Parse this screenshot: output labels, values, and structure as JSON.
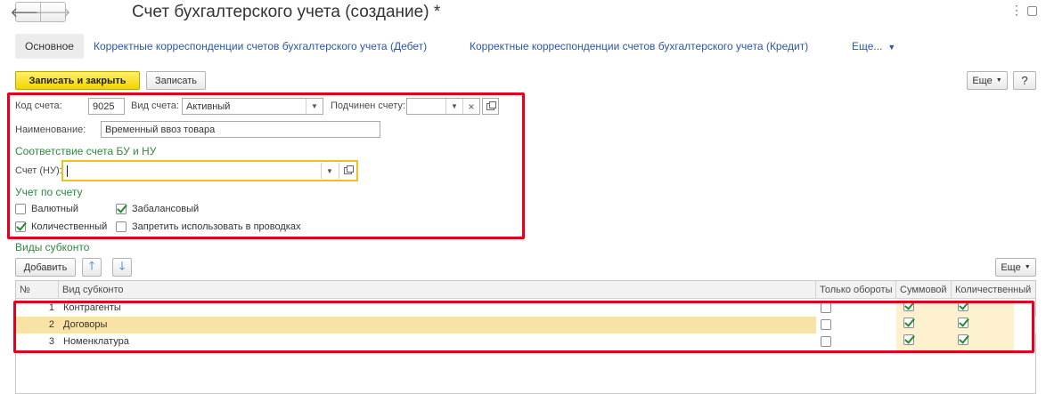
{
  "nav": {
    "back_icon": "arrow-left-icon",
    "forward_icon": "arrow-right-icon",
    "back_glyph": "🡐",
    "forward_glyph": "🡒"
  },
  "window": {
    "title": "Счет бухгалтерского учета (создание) *",
    "menu_glyph": "⋮",
    "resize_glyph": "▢"
  },
  "tabs": {
    "main": "Основное",
    "links": [
      "Корректные корреспонденции счетов бухгалтерского учета (Дебет)",
      "Корректные корреспонденции счетов бухгалтерского учета (Кредит)"
    ],
    "more": "Еще...",
    "more_glyph": "▼"
  },
  "toolbar": {
    "save_close": "Записать и закрыть",
    "save": "Записать",
    "more": "Еще",
    "help": "?",
    "dropdown_glyph": "▼"
  },
  "form": {
    "code_label": "Код счета:",
    "code_value": "9025",
    "type_label": "Вид счета:",
    "type_value": "Активный",
    "parent_label": "Подчинен счету:",
    "parent_value": "",
    "name_label": "Наименование:",
    "name_value": "Временный ввоз товара",
    "clear_glyph": "×",
    "dropdown_glyph": "▼"
  },
  "nu_section": {
    "title": "Соответствие счета БУ и НУ",
    "account_label": "Счет (НУ):",
    "account_value": ""
  },
  "accounting": {
    "title": "Учет по счету",
    "checkboxes": [
      {
        "label": "Валютный",
        "checked": false
      },
      {
        "label": "Забалансовый",
        "checked": true
      },
      {
        "label": "Количественный",
        "checked": true
      },
      {
        "label": "Запретить использовать в проводках",
        "checked": false
      }
    ]
  },
  "subconto": {
    "title": "Виды субконто",
    "add": "Добавить",
    "up_glyph": "🡑",
    "down_glyph": "🡓",
    "more": "Еще",
    "columns": [
      "№",
      "Вид субконто",
      "Только обороты",
      "Суммовой",
      "Количественный"
    ],
    "rows": [
      {
        "n": "1",
        "name": "Контрагенты",
        "turnover_only": false,
        "sum": true,
        "qty": true
      },
      {
        "n": "2",
        "name": "Договоры",
        "turnover_only": false,
        "sum": true,
        "qty": true
      },
      {
        "n": "3",
        "name": "Номенклатура",
        "turnover_only": false,
        "sum": true,
        "qty": true
      }
    ]
  },
  "colors": {
    "accent_green": "#2b8a3e",
    "link_blue": "#2a57a5",
    "highlight_red": "#e4001c",
    "primary_yellow": "#f2d300"
  }
}
